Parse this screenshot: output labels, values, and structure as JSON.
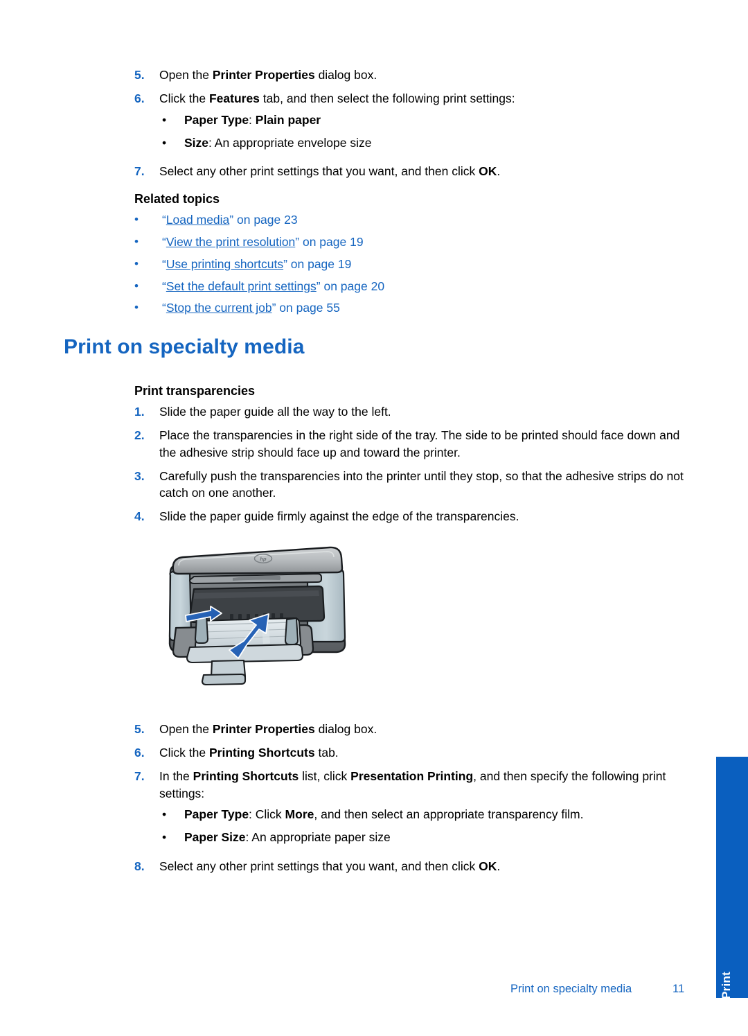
{
  "document": {
    "page_number": "11",
    "footer_title": "Print on specialty media",
    "side_tab_label": "Print",
    "colors": {
      "accent_blue": "#1565C0",
      "tab_blue": "#0A5FBF",
      "link_blue": "#1565C0",
      "text_black": "#000000"
    }
  },
  "top_steps": [
    {
      "number": "5.",
      "segments": [
        {
          "text": "Open the ",
          "bold": false
        },
        {
          "text": "Printer Properties",
          "bold": true
        },
        {
          "text": " dialog box.",
          "bold": false
        }
      ]
    },
    {
      "number": "6.",
      "segments": [
        {
          "text": "Click the ",
          "bold": false
        },
        {
          "text": "Features",
          "bold": true
        },
        {
          "text": " tab, and then select the following print settings:",
          "bold": false
        }
      ],
      "subbullets": [
        {
          "bullet": "•",
          "segments": [
            {
              "text": "Paper Type",
              "bold": true
            },
            {
              "text": ": ",
              "bold": false
            },
            {
              "text": "Plain paper",
              "bold": true
            }
          ]
        },
        {
          "bullet": "•",
          "segments": [
            {
              "text": "Size",
              "bold": true
            },
            {
              "text": ": An appropriate envelope size",
              "bold": false
            }
          ]
        }
      ]
    },
    {
      "number": "7.",
      "segments": [
        {
          "text": "Select any other print settings that you want, and then click ",
          "bold": false
        },
        {
          "text": "OK",
          "bold": true
        },
        {
          "text": ".",
          "bold": false
        }
      ]
    }
  ],
  "related_topics": {
    "heading": "Related topics",
    "items": [
      {
        "bullet": "•",
        "open_quote": "“",
        "link": "Load media",
        "close_quote": "”",
        "suffix": " on page 23"
      },
      {
        "bullet": "•",
        "open_quote": "“",
        "link": "View the print resolution",
        "close_quote": "”",
        "suffix": " on page 19"
      },
      {
        "bullet": "•",
        "open_quote": "“",
        "link": "Use printing shortcuts",
        "close_quote": "”",
        "suffix": " on page 19"
      },
      {
        "bullet": "•",
        "open_quote": "“",
        "link": "Set the default print settings",
        "close_quote": "”",
        "suffix": " on page 20"
      },
      {
        "bullet": "•",
        "open_quote": "“",
        "link": "Stop the current job",
        "close_quote": "”",
        "suffix": " on page 55"
      }
    ]
  },
  "section": {
    "heading": "Print on specialty media",
    "subheading": "Print transparencies"
  },
  "transparency_steps": [
    {
      "number": "1.",
      "segments": [
        {
          "text": "Slide the paper guide all the way to the left.",
          "bold": false
        }
      ]
    },
    {
      "number": "2.",
      "segments": [
        {
          "text": "Place the transparencies in the right side of the tray. The side to be printed should face down and the adhesive strip should face up and toward the printer.",
          "bold": false
        }
      ]
    },
    {
      "number": "3.",
      "segments": [
        {
          "text": "Carefully push the transparencies into the printer until they stop, so that the adhesive strips do not catch on one another.",
          "bold": false
        }
      ]
    },
    {
      "number": "4.",
      "segments": [
        {
          "text": "Slide the paper guide firmly against the edge of the transparencies.",
          "bold": false
        }
      ]
    }
  ],
  "figure": {
    "name": "hp-all-in-one-printer-illustration",
    "logo": "hp",
    "arrows": [
      {
        "name": "paper-guide-arrow",
        "direction": "right"
      },
      {
        "name": "paper-insert-arrow",
        "direction": "up-right"
      }
    ]
  },
  "bottom_steps": [
    {
      "number": "5.",
      "segments": [
        {
          "text": "Open the ",
          "bold": false
        },
        {
          "text": "Printer Properties",
          "bold": true
        },
        {
          "text": " dialog box.",
          "bold": false
        }
      ]
    },
    {
      "number": "6.",
      "segments": [
        {
          "text": "Click the ",
          "bold": false
        },
        {
          "text": "Printing Shortcuts",
          "bold": true
        },
        {
          "text": " tab.",
          "bold": false
        }
      ]
    },
    {
      "number": "7.",
      "segments": [
        {
          "text": "In the ",
          "bold": false
        },
        {
          "text": "Printing Shortcuts",
          "bold": true
        },
        {
          "text": " list, click ",
          "bold": false
        },
        {
          "text": "Presentation Printing",
          "bold": true
        },
        {
          "text": ", and then specify the following print settings:",
          "bold": false
        }
      ],
      "subbullets": [
        {
          "bullet": "•",
          "segments": [
            {
              "text": "Paper Type",
              "bold": true
            },
            {
              "text": ": Click ",
              "bold": false
            },
            {
              "text": "More",
              "bold": true
            },
            {
              "text": ", and then select an appropriate transparency film.",
              "bold": false
            }
          ]
        },
        {
          "bullet": "•",
          "segments": [
            {
              "text": "Paper Size",
              "bold": true
            },
            {
              "text": ": An appropriate paper size",
              "bold": false
            }
          ]
        }
      ]
    },
    {
      "number": "8.",
      "segments": [
        {
          "text": "Select any other print settings that you want, and then click ",
          "bold": false
        },
        {
          "text": "OK",
          "bold": true
        },
        {
          "text": ".",
          "bold": false
        }
      ]
    }
  ]
}
